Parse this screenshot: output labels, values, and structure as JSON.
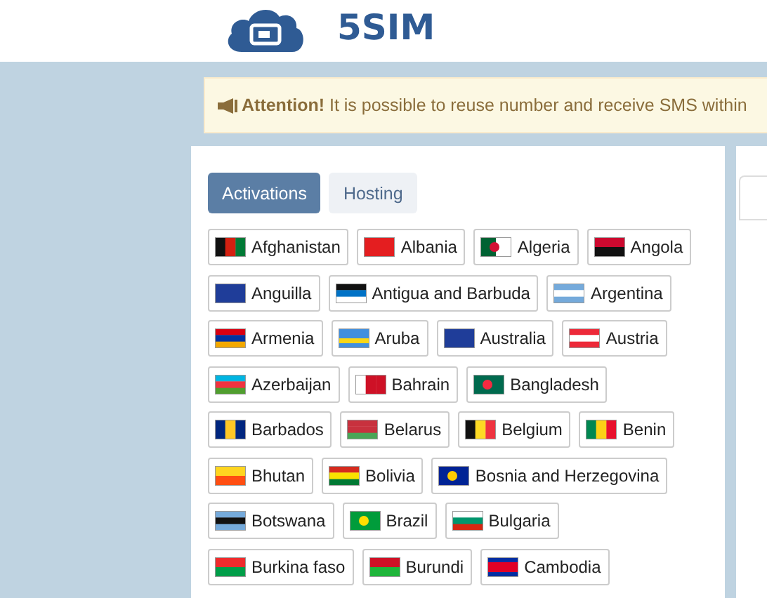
{
  "header": {
    "brand": "5SIM"
  },
  "alert": {
    "title": "Attention!",
    "text": "It is possible to reuse number and receive SMS within"
  },
  "tabs": [
    {
      "label": "Activations",
      "selected": true
    },
    {
      "label": "Hosting",
      "selected": false
    }
  ],
  "countries": [
    {
      "name": "Afghanistan"
    },
    {
      "name": "Albania"
    },
    {
      "name": "Algeria"
    },
    {
      "name": "Angola"
    },
    {
      "name": "Anguilla"
    },
    {
      "name": "Antigua and Barbuda"
    },
    {
      "name": "Argentina"
    },
    {
      "name": "Armenia"
    },
    {
      "name": "Aruba"
    },
    {
      "name": "Australia"
    },
    {
      "name": "Austria"
    },
    {
      "name": "Azerbaijan"
    },
    {
      "name": "Bahrain"
    },
    {
      "name": "Bangladesh"
    },
    {
      "name": "Barbados"
    },
    {
      "name": "Belarus"
    },
    {
      "name": "Belgium"
    },
    {
      "name": "Benin"
    },
    {
      "name": "Bhutan"
    },
    {
      "name": "Bolivia"
    },
    {
      "name": "Bosnia and Herzegovina"
    },
    {
      "name": "Botswana"
    },
    {
      "name": "Brazil"
    },
    {
      "name": "Bulgaria"
    },
    {
      "name": "Burkina faso"
    },
    {
      "name": "Burundi"
    },
    {
      "name": "Cambodia"
    }
  ]
}
